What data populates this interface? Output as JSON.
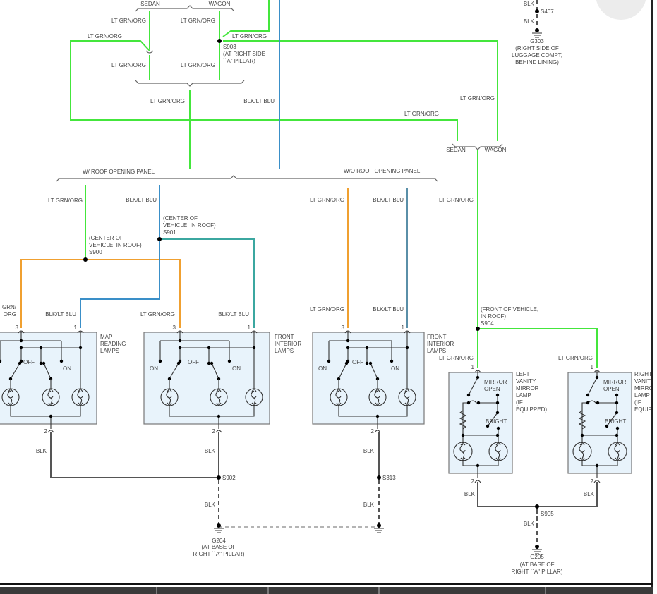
{
  "colors": {
    "lt_grn_org": "#44e63c",
    "org": "#f0a030",
    "blk_lt_blu": "#3a8fc8",
    "blk": "#555555",
    "component_fill": "#e8f3fb"
  },
  "options": {
    "top_sedan": "SEDAN",
    "top_wagon": "WAGON",
    "mid_sedan": "SEDAN",
    "mid_wagon": "WAGON",
    "w_roof": "W/ ROOF OPENING PANEL",
    "wo_roof": "W/O ROOF OPENING PANEL"
  },
  "wire_labels": [
    "LT GRN/ORG",
    "LT GRN/ORG",
    "LT GRN/ORG",
    "LT GRN/ORG",
    "LT GRN/ORG",
    "LT GRN/ORG",
    "LT GRN/ORG",
    "BLK/LT BLU",
    "BLK",
    "BLK",
    "LT GRN/ORG",
    "LT GRN/ORG",
    "LT GRN/ORG",
    "BLK/LT BLU",
    "LT GRN/ORG",
    "BLK/LT BLU",
    "LT GRN/ORG",
    "BLK/LT BLU",
    "LT GRN/ORG",
    "BLK/LT BLU",
    "LT GRN/ORG",
    "BLK/LT BLU",
    "LT GRN/ORG",
    "LT GRN/ORG",
    "BLK",
    "BLK",
    "BLK",
    "BLK",
    "BLK",
    "BLK",
    "BLK",
    "BLK"
  ],
  "split_label": [
    "GRN/",
    "ORG"
  ],
  "splices": {
    "s903": {
      "id": "S903",
      "loc": [
        "(AT RIGHT SIDE",
        "``A\" PILLAR)"
      ]
    },
    "s407": {
      "id": "S407"
    },
    "s901": {
      "id": "S901",
      "loc": [
        "(CENTER OF",
        "VEHICLE, IN ROOF)"
      ]
    },
    "s900": {
      "id": "S900",
      "loc": [
        "(CENTER OF",
        "VEHICLE, IN ROOF)"
      ]
    },
    "s904": {
      "id": "S904",
      "loc": [
        "(FRONT OF VEHICLE,",
        "IN ROOF)"
      ]
    },
    "s902": {
      "id": "S902"
    },
    "s313": {
      "id": "S313"
    },
    "s905": {
      "id": "S905"
    }
  },
  "grounds": {
    "g303": {
      "id": "G303",
      "loc": [
        "(RIGHT SIDE OF",
        "LUGGAGE COMPT,",
        "BEHIND LINING)"
      ]
    },
    "g204": {
      "id": "G204",
      "loc": [
        "(AT BASE OF",
        "RIGHT ``A\" PILLAR)"
      ]
    },
    "g205": {
      "id": "G205",
      "loc": [
        "(AT BASE OF",
        "RIGHT ``A\" PILLAR)"
      ]
    }
  },
  "components": {
    "map": {
      "name": [
        "MAP",
        "READING",
        "LAMPS"
      ],
      "pins": [
        "3",
        "1",
        "2"
      ],
      "switch": [
        "OFF",
        "ON"
      ]
    },
    "front1": {
      "name": [
        "FRONT",
        "INTERIOR",
        "LAMPS"
      ],
      "pins": [
        "3",
        "1",
        "2"
      ],
      "switch": [
        "ON",
        "OFF",
        "ON"
      ]
    },
    "front2": {
      "name": [
        "FRONT",
        "INTERIOR",
        "LAMPS"
      ],
      "pins": [
        "3",
        "1",
        "2"
      ],
      "switch": [
        "ON",
        "OFF",
        "ON"
      ]
    },
    "lvan": {
      "name": [
        "LEFT",
        "VANITY",
        "MIRROR",
        "LAMP",
        "(IF",
        "EQUIPPED)"
      ],
      "pins": [
        "1",
        "2"
      ],
      "switch": [
        "MIRROR",
        "OPEN",
        "BRIGHT"
      ]
    },
    "rvan": {
      "name": [
        "RIGHT",
        "VANITY",
        "MIRROR",
        "LAMP",
        "(IF",
        "EQUIPPED)"
      ],
      "pins": [
        "1",
        "2"
      ],
      "switch": [
        "MIRROR",
        "OPEN",
        "BRIGHT"
      ]
    }
  }
}
